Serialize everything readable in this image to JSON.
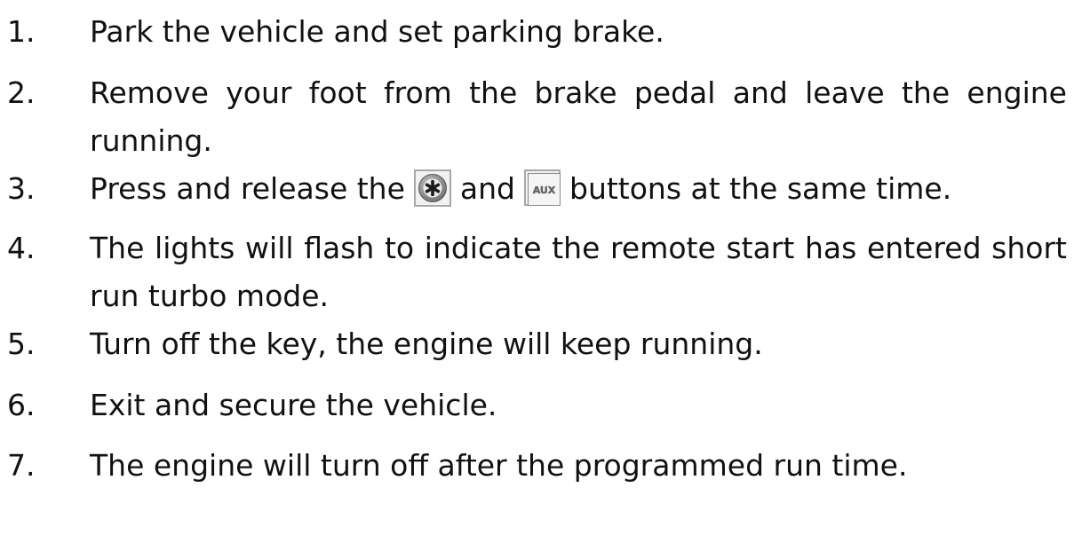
{
  "steps": [
    {
      "num": "1.",
      "text": "Park the vehicle and set parking brake."
    },
    {
      "num": "2.",
      "text": "Remove your foot from the brake pedal and leave the engine running."
    },
    {
      "num": "3.",
      "text_before": "Press and release the",
      "text_middle": "and",
      "text_after": "buttons at the same time.",
      "icon_1": "star-button-icon",
      "icon_2": "aux-button-icon"
    },
    {
      "num": "4.",
      "text": "The lights will flash to indicate the remote start has entered short run turbo mode."
    },
    {
      "num": "5.",
      "text": "Turn off the key, the engine will keep running."
    },
    {
      "num": "6.",
      "text": "Exit and secure the vehicle."
    },
    {
      "num": "7.",
      "text": "The engine will turn off after the programmed run time."
    }
  ],
  "aux_label": "AUX"
}
